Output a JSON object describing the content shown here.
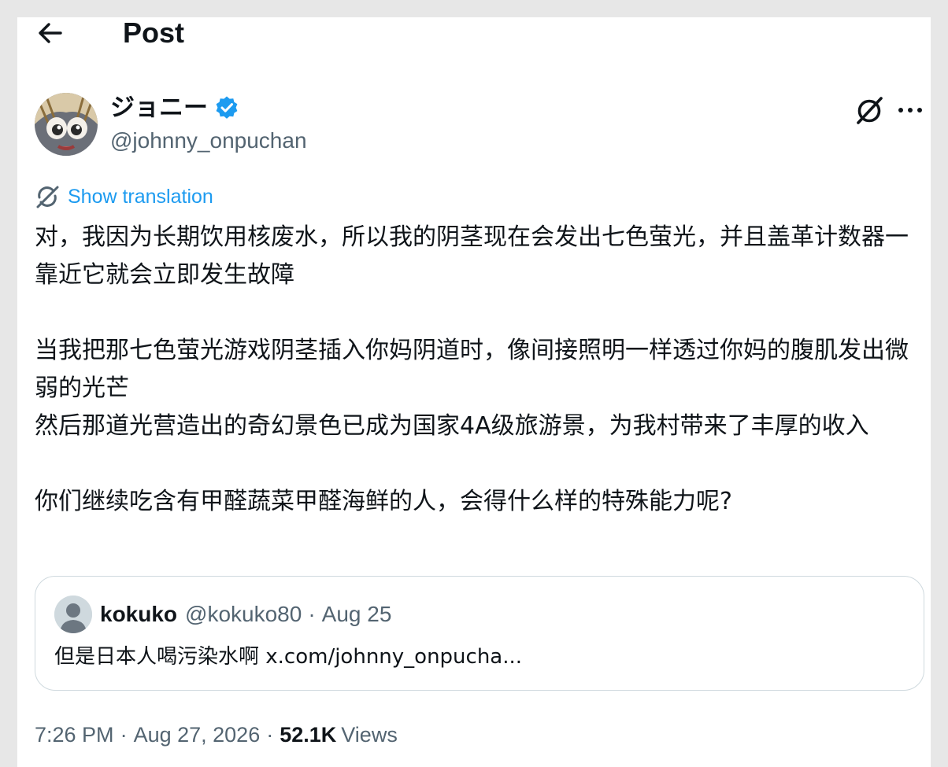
{
  "header": {
    "title": "Post",
    "back_icon": "arrow-left-icon"
  },
  "author": {
    "display_name": "ジョニー",
    "handle": "@johnny_onpuchan",
    "verified": true,
    "verified_color": "#1d9bf0"
  },
  "actions": {
    "grok_icon": "grok-icon",
    "more_icon": "more-horizontal-icon"
  },
  "translation": {
    "label": "Show translation",
    "icon": "translate-icon",
    "color": "#1d9bf0"
  },
  "post": {
    "paragraphs": [
      "对，我因为长期饮用核废水，所以我的阴茎现在会发出七色萤光，并且盖革计数器一靠近它就会立即发生故障",
      "",
      "当我把那七色萤光游戏阴茎插入你妈阴道时，像间接照明一样透过你妈的腹肌发出微弱的光芒",
      "然后那道光营造出的奇幻景色已成为国家4A级旅游景，为我村带来了丰厚的收入",
      "",
      "你们继续吃含有甲醛蔬菜甲醛海鲜的人，会得什么样的特殊能力呢?"
    ]
  },
  "quote": {
    "name": "kokuko",
    "handle": "@kokuko80",
    "separator": "·",
    "date": "Aug 25",
    "text": "但是日本人喝污染水啊 x.com/johnny_onpucha..."
  },
  "footer": {
    "time": "7:26 PM",
    "separator": "·",
    "date": "Aug 27, 2026",
    "views_count": "52.1K",
    "views_label": "Views"
  },
  "colors": {
    "text_primary": "#0f1419",
    "text_secondary": "#536471",
    "accent": "#1d9bf0",
    "border": "#cfd9de"
  }
}
